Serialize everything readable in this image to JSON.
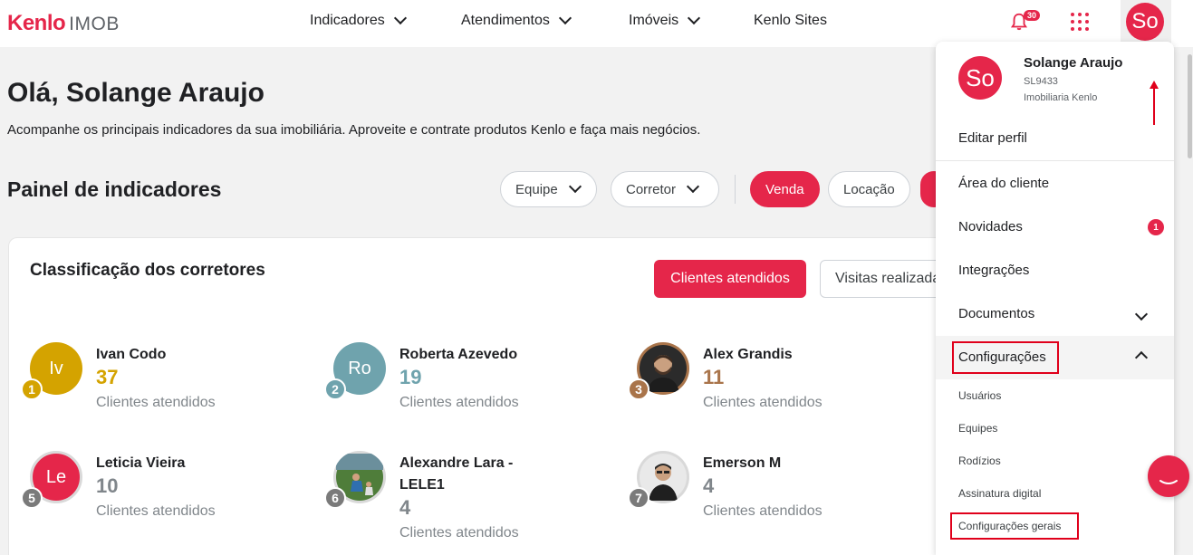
{
  "header": {
    "logo_brand": "Kenlo",
    "logo_product": "IMOB",
    "nav": [
      "Indicadores",
      "Atendimentos",
      "Imóveis",
      "Kenlo Sites"
    ],
    "notifications_count": "30",
    "avatar_initials": "So"
  },
  "main": {
    "greeting": "Olá, Solange Araujo",
    "subtitle": "Acompanhe os principais indicadores da sua imobiliária. Aproveite e contrate produtos Kenlo e faça mais negócios.",
    "panel_title": "Painel de indicadores",
    "filters": {
      "team": "Equipe",
      "broker": "Corretor",
      "sale": "Venda",
      "rent": "Locação"
    }
  },
  "ranking": {
    "title": "Classificação dos corretores",
    "tab_active": "Clientes atendidos",
    "tab_other": "Visitas realizadas",
    "brokers": [
      {
        "rank": "1",
        "initials": "Iv",
        "name": "Ivan Codo",
        "count": "37",
        "label": "Clientes atendidos",
        "color": "#d4a300"
      },
      {
        "rank": "2",
        "initials": "Ro",
        "name": "Roberta Azevedo",
        "count": "19",
        "label": "Clientes atendidos",
        "color": "#6fa3ad"
      },
      {
        "rank": "3",
        "initials": "",
        "name": "Alex Grandis",
        "count": "11",
        "label": "Clientes atendidos",
        "color": "#a9744a"
      },
      {
        "rank": "5",
        "initials": "Le",
        "name": "Leticia Vieira",
        "count": "10",
        "label": "Clientes atendidos",
        "color": "#e5264a"
      },
      {
        "rank": "6",
        "initials": "",
        "name": "Alexandre Lara -",
        "name2": "LELE1",
        "count": "4",
        "label": "Clientes atendidos",
        "color": "#7a7a7a"
      },
      {
        "rank": "7",
        "initials": "",
        "name": "Emerson M",
        "count": "4",
        "label": "Clientes atendidos",
        "color": "#7a7a7a"
      }
    ]
  },
  "profile_menu": {
    "initials": "So",
    "name": "Solange Araujo",
    "code": "SL9433",
    "company": "Imobiliaria Kenlo",
    "edit_profile": "Editar perfil",
    "items": {
      "client_area": "Área do cliente",
      "news": "Novidades",
      "news_badge": "1",
      "integrations": "Integrações",
      "documents": "Documentos",
      "settings": "Configurações"
    },
    "settings_sub": [
      "Usuários",
      "Equipes",
      "Rodízios",
      "Assinatura digital",
      "Configurações gerais"
    ]
  },
  "colors": {
    "brand": "#e5264a",
    "highlight": "#e0001b"
  }
}
